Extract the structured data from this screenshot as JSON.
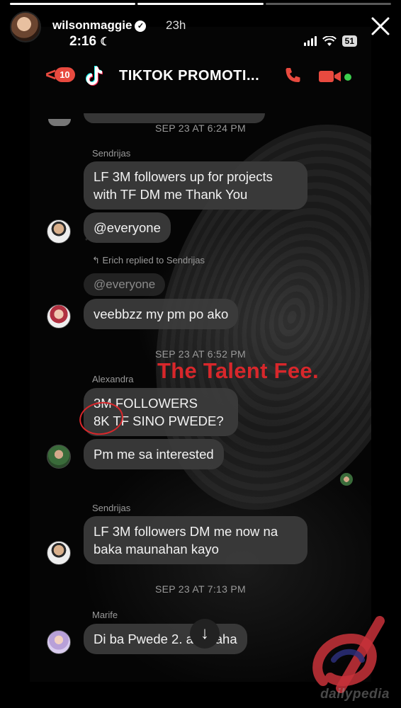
{
  "story": {
    "username": "wilsonmaggie",
    "verified_mark": "✓",
    "time_ago": "23h",
    "progress": {
      "segments": 3,
      "viewed": 2
    }
  },
  "status_bar": {
    "clock": "2:16",
    "moon": "☾",
    "battery": "51"
  },
  "chat": {
    "back_count": "10",
    "back_chevron": "<",
    "title": "TIKTOK PROMOTI...",
    "messages": [
      {
        "type": "timestamp",
        "text": "SEP 23 AT 6:24 PM"
      },
      {
        "type": "sender",
        "text": "Sendrijas"
      },
      {
        "type": "bubble",
        "text": "LF 3M followers up for projects\nwith TF DM me Thank You"
      },
      {
        "type": "bubble",
        "text": "@everyone"
      },
      {
        "type": "reply_note",
        "text": "Erich replied to Sendrijas"
      },
      {
        "type": "quoted",
        "text": "@everyone"
      },
      {
        "type": "bubble",
        "text": "veebbzz my pm po ako"
      },
      {
        "type": "timestamp",
        "text": "SEP 23 AT 6:52 PM"
      },
      {
        "type": "sender",
        "text": "Alexandra"
      },
      {
        "type": "bubble",
        "text": "3M FOLLOWERS\n8K TF SINO PWEDE?"
      },
      {
        "type": "bubble",
        "text": "Pm me sa interested"
      },
      {
        "type": "sender",
        "text": "Sendrijas"
      },
      {
        "type": "bubble",
        "text": "LF 3M followers DM me now na\nbaka maunahan kayo"
      },
      {
        "type": "timestamp",
        "text": "SEP 23 AT 7:13 PM"
      },
      {
        "type": "sender",
        "text": "Marife"
      },
      {
        "type": "bubble",
        "text": "Di ba Pwede 2.          ahahaha"
      }
    ]
  },
  "overlay": {
    "caption": "The Talent Fee."
  },
  "scroll_down_arrow": "↓",
  "watermark": {
    "text": "dailypedia",
    "colors": {
      "red": "#c8323a",
      "navy": "#2b2f7a"
    }
  }
}
